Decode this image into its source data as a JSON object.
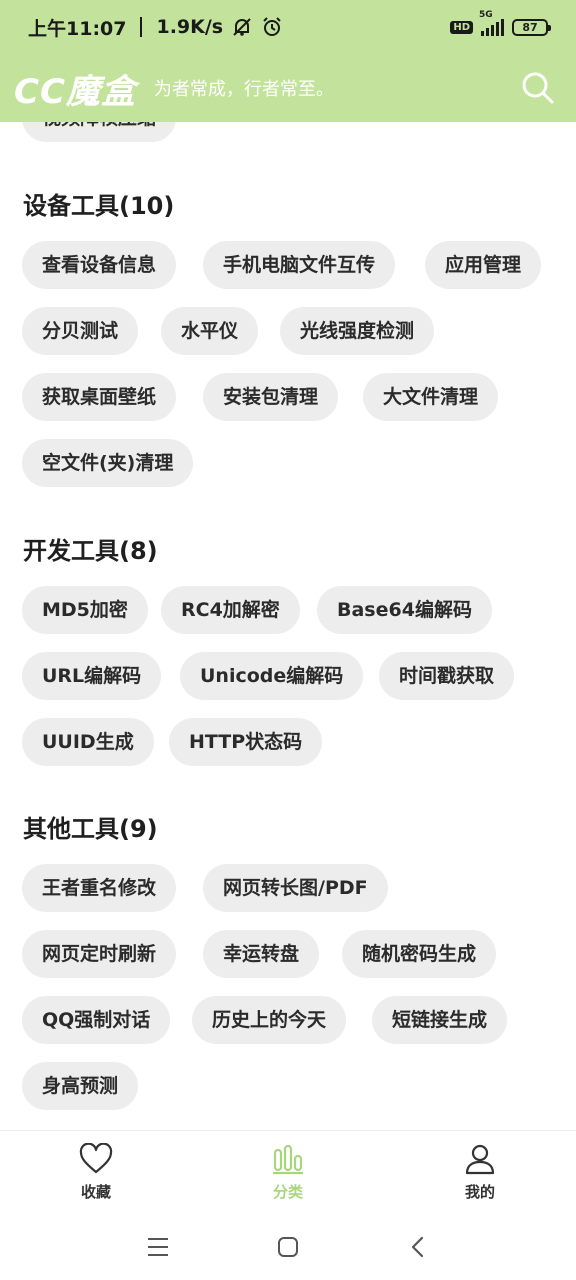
{
  "status": {
    "time": "上午11:07",
    "speed": "1.9K/s",
    "battery": "87",
    "net_label": "5G",
    "hd_label": "HD"
  },
  "header": {
    "logo": "CC魔盒",
    "slogan": "为者常成，行者常至。"
  },
  "partial_chip": "视频降帧压缩",
  "sections": [
    {
      "title": "设备工具(10)",
      "items": [
        "查看设备信息",
        "手机电脑文件互传",
        "应用管理",
        "分贝测试",
        "水平仪",
        "光线强度检测",
        "获取桌面壁纸",
        "安装包清理",
        "大文件清理",
        "空文件(夹)清理"
      ]
    },
    {
      "title": "开发工具(8)",
      "items": [
        "MD5加密",
        "RC4加解密",
        "Base64编解码",
        "URL编解码",
        "Unicode编解码",
        "时间戳获取",
        "UUID生成",
        "HTTP状态码"
      ]
    },
    {
      "title": "其他工具(9)",
      "items": [
        "王者重名修改",
        "网页转长图/PDF",
        "网页定时刷新",
        "幸运转盘",
        "随机密码生成",
        "QQ强制对话",
        "历史上的今天",
        "短链接生成",
        "身高预测"
      ]
    }
  ],
  "bottom_nav": [
    {
      "label": "收藏",
      "icon": "heart-icon",
      "active": false
    },
    {
      "label": "分类",
      "icon": "bar-chart-icon",
      "active": true
    },
    {
      "label": "我的",
      "icon": "person-icon",
      "active": false
    }
  ],
  "colors": {
    "header_bg": "#c3e39c",
    "active_nav": "#a8d67e",
    "chip_bg": "#ededed"
  }
}
